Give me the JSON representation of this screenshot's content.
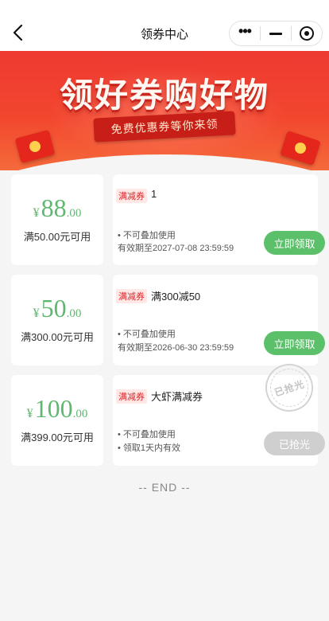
{
  "header": {
    "title": "领券中心"
  },
  "banner": {
    "headline": "领好券购好物",
    "subtitle": "免费优惠券等你来领"
  },
  "coupons": [
    {
      "currency": "¥",
      "amount_int": "88",
      "amount_dec": ".00",
      "condition": "满50.00元可用",
      "tag": "满减券",
      "name": "1",
      "note1": "• 不可叠加使用",
      "note2": "有效期至2027-07-08 23:59:59",
      "button": "立即领取"
    },
    {
      "currency": "¥",
      "amount_int": "50",
      "amount_dec": ".00",
      "condition": "满300.00元可用",
      "tag": "满减券",
      "name": "满300减50",
      "note1": "• 不可叠加使用",
      "note2": "有效期至2026-06-30 23:59:59",
      "button": "立即领取"
    },
    {
      "currency": "¥",
      "amount_int": "100",
      "amount_dec": ".00",
      "condition": "满399.00元可用",
      "tag": "满减券",
      "name": "大虾满减券",
      "note1": "• 不可叠加使用",
      "note2": "• 领取1天内有效",
      "button": "已抢光",
      "stamp": "已抢光"
    }
  ],
  "footer": {
    "end_text": "-- END --"
  },
  "colors": {
    "accent_green": "#5cc06b",
    "price_green": "#5fb86f",
    "banner_red": "#ee3a32",
    "tag_red": "#d8262a",
    "disabled_gray": "#cfcfcf"
  }
}
